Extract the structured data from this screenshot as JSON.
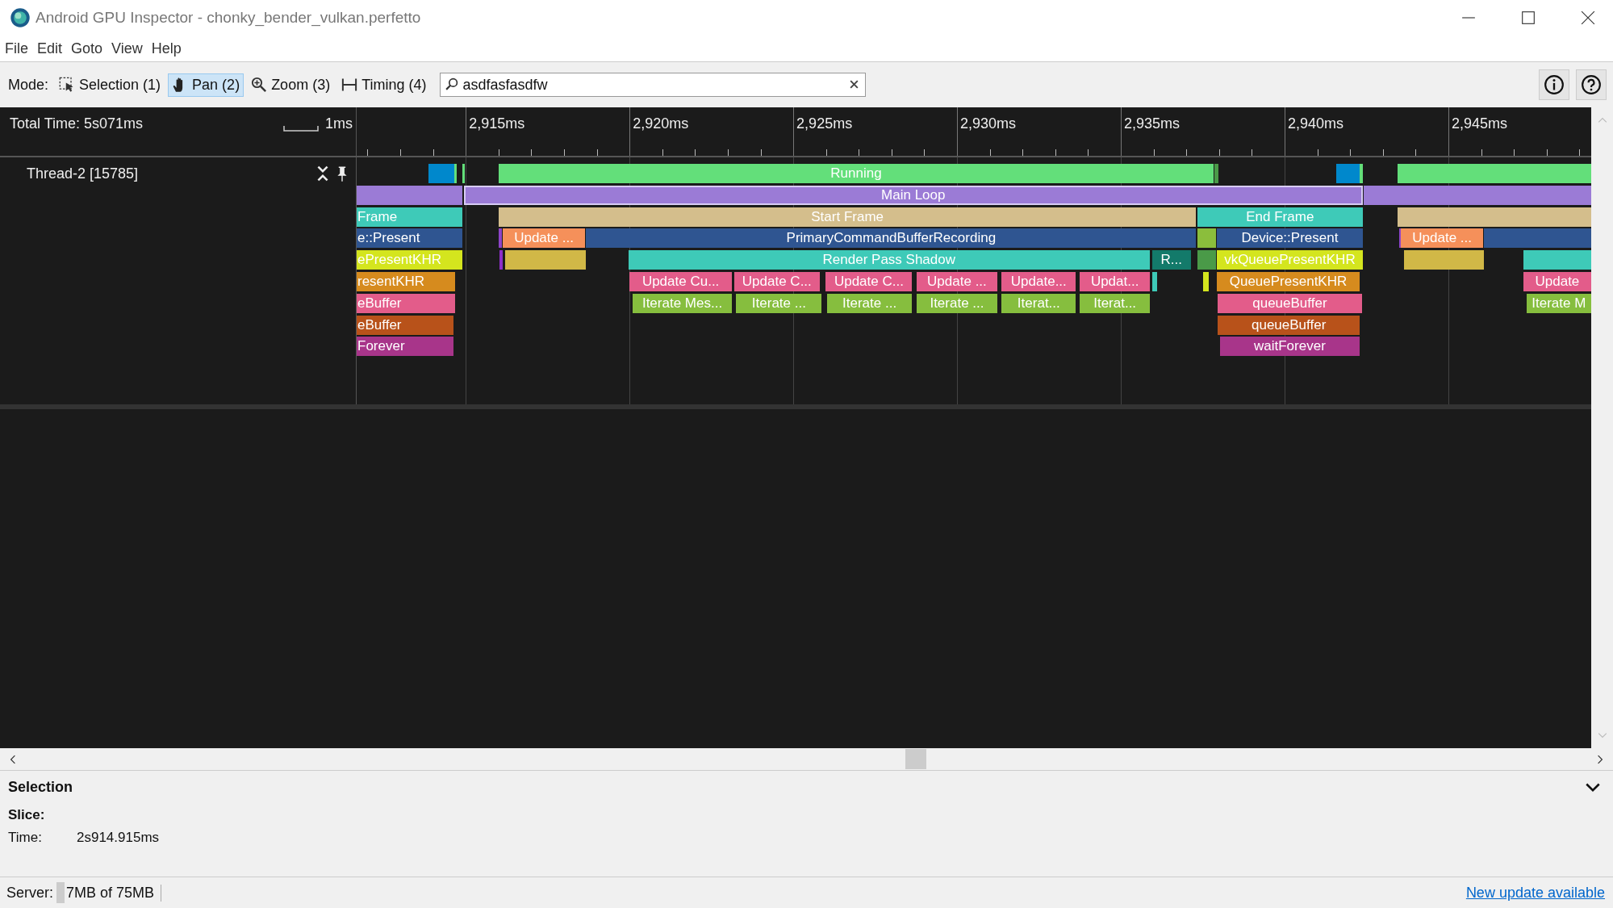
{
  "window": {
    "title": "Android GPU Inspector - chonky_bender_vulkan.perfetto"
  },
  "menu": [
    "File",
    "Edit",
    "Goto",
    "View",
    "Help"
  ],
  "toolbar": {
    "mode_label": "Mode:",
    "modes": [
      {
        "kind": "selection",
        "label": "Selection (1)",
        "selected": false
      },
      {
        "kind": "pan",
        "label": "Pan (2)",
        "selected": true
      },
      {
        "kind": "zoom",
        "label": "Zoom (3)",
        "selected": false
      },
      {
        "kind": "timing",
        "label": "Timing (4)",
        "selected": false
      }
    ],
    "search": {
      "value": "asdfasfasdfw"
    }
  },
  "timeline": {
    "total_time": "Total Time: 5s071ms",
    "scale_label": "1ms",
    "ticks": [
      "2,915ms",
      "2,920ms",
      "2,925ms",
      "2,930ms",
      "2,935ms",
      "2,940ms",
      "2,945ms"
    ]
  },
  "tracks": [
    {
      "name": "Thread-2 [15785]",
      "rows": [
        {
          "slices": [
            {
              "color": "#0088cc",
              "selected": false
            },
            {
              "color": "#63df7a",
              "selected": false
            },
            {
              "color": "#63df7a",
              "selected": false
            },
            {
              "label": "Running",
              "color": "#63df7a",
              "selected": false
            },
            {
              "color": "#4a9a48",
              "selected": false
            },
            {
              "color": "#0088cc",
              "selected": false
            },
            {
              "color": "#63df7a",
              "selected": false
            },
            {
              "color": "#63df7a",
              "selected": false
            }
          ]
        },
        {
          "slices": [
            {
              "color": "#9b7bd6",
              "selected": false
            },
            {
              "label": "Main Loop",
              "color": "#9b7bd6",
              "selected": true
            },
            {
              "color": "#9b7bd6",
              "selected": false
            }
          ]
        },
        {
          "slices": [
            {
              "label": "Frame",
              "color": "#3ecab8",
              "selected": false
            },
            {
              "label": "Start Frame",
              "color": "#d4be8c",
              "selected": false
            },
            {
              "label": "End Frame",
              "color": "#3ecab8",
              "selected": false
            },
            {
              "color": "#d4be8c",
              "selected": false
            }
          ]
        },
        {
          "slices": [
            {
              "label": "e::Present",
              "color": "#2f5591",
              "selected": false
            },
            {
              "color": "#8e44c8",
              "selected": false
            },
            {
              "label": "Update ...",
              "color": "#f5905a",
              "selected": false
            },
            {
              "label": "PrimaryCommandBufferRecording",
              "color": "#2f5591",
              "selected": false
            },
            {
              "color": "#8bbe3c",
              "selected": false
            },
            {
              "label": "Device::Present",
              "color": "#2f5591",
              "selected": false
            },
            {
              "color": "#8e44c8",
              "selected": false
            },
            {
              "label": "Update ...",
              "color": "#f5905a",
              "selected": false
            },
            {
              "color": "#2f5591",
              "selected": false
            }
          ]
        },
        {
          "slices": [
            {
              "label": "ePresentKHR",
              "color": "#d4e51e",
              "selected": false
            },
            {
              "color": "#8e2ec8",
              "selected": false
            },
            {
              "color": "#d1b847",
              "selected": false
            },
            {
              "label": "Render Pass Shadow",
              "color": "#3ecab8",
              "selected": false
            },
            {
              "label": "R...",
              "color": "#137a6a",
              "selected": false
            },
            {
              "color": "#4a9a48",
              "selected": false
            },
            {
              "label": "vkQueuePresentKHR",
              "color": "#d4e51e",
              "selected": false
            },
            {
              "color": "#d1b847",
              "selected": false
            },
            {
              "color": "#3ecab8",
              "selected": false
            }
          ]
        },
        {
          "slices": [
            {
              "label": "resentKHR",
              "color": "#d68b1e",
              "selected": false
            },
            {
              "label": "Update Cu...",
              "color": "#e35c8a",
              "selected": false
            },
            {
              "label": "Update C...",
              "color": "#e35c8a",
              "selected": false
            },
            {
              "label": "Update C...",
              "color": "#e35c8a",
              "selected": false
            },
            {
              "label": "Update ...",
              "color": "#e35c8a",
              "selected": false
            },
            {
              "label": "Update...",
              "color": "#e35c8a",
              "selected": false
            },
            {
              "label": "Updat...",
              "color": "#e35c8a",
              "selected": false
            },
            {
              "color": "#3ecab8",
              "selected": false
            },
            {
              "color": "#d4e51e",
              "selected": false
            },
            {
              "label": "QueuePresentKHR",
              "color": "#d68b1e",
              "selected": false
            },
            {
              "label": "Update",
              "color": "#e35c8a",
              "selected": false
            }
          ]
        },
        {
          "slices": [
            {
              "label": "eBuffer",
              "color": "#e35c8a",
              "selected": false
            },
            {
              "label": "Iterate Mes...",
              "color": "#86be3e",
              "selected": false
            },
            {
              "label": "Iterate ...",
              "color": "#86be3e",
              "selected": false
            },
            {
              "label": "Iterate ...",
              "color": "#86be3e",
              "selected": false
            },
            {
              "label": "Iterate ...",
              "color": "#86be3e",
              "selected": false
            },
            {
              "label": "Iterat...",
              "color": "#86be3e",
              "selected": false
            },
            {
              "label": "Iterat...",
              "color": "#86be3e",
              "selected": false
            },
            {
              "label": "queueBuffer",
              "color": "#e35c8a",
              "selected": false
            },
            {
              "label": "Iterate M",
              "color": "#86be3e",
              "selected": false
            }
          ]
        },
        {
          "slices": [
            {
              "label": "eBuffer",
              "color": "#b8521a",
              "selected": false
            },
            {
              "label": "queueBuffer",
              "color": "#b8521a",
              "selected": false
            }
          ]
        },
        {
          "slices": [
            {
              "label": "Forever",
              "color": "#a8358a",
              "selected": false
            },
            {
              "label": "waitForever",
              "color": "#a8358a",
              "selected": false
            }
          ]
        }
      ]
    }
  ],
  "selection_panel": {
    "title": "Selection",
    "fields": [
      {
        "label": "Slice:"
      },
      {
        "label": "Time:",
        "value": "2s914.915ms"
      }
    ]
  },
  "status_bar": {
    "server_label": "Server:",
    "memory": "7MB of 75MB",
    "update_link": "New update available"
  }
}
